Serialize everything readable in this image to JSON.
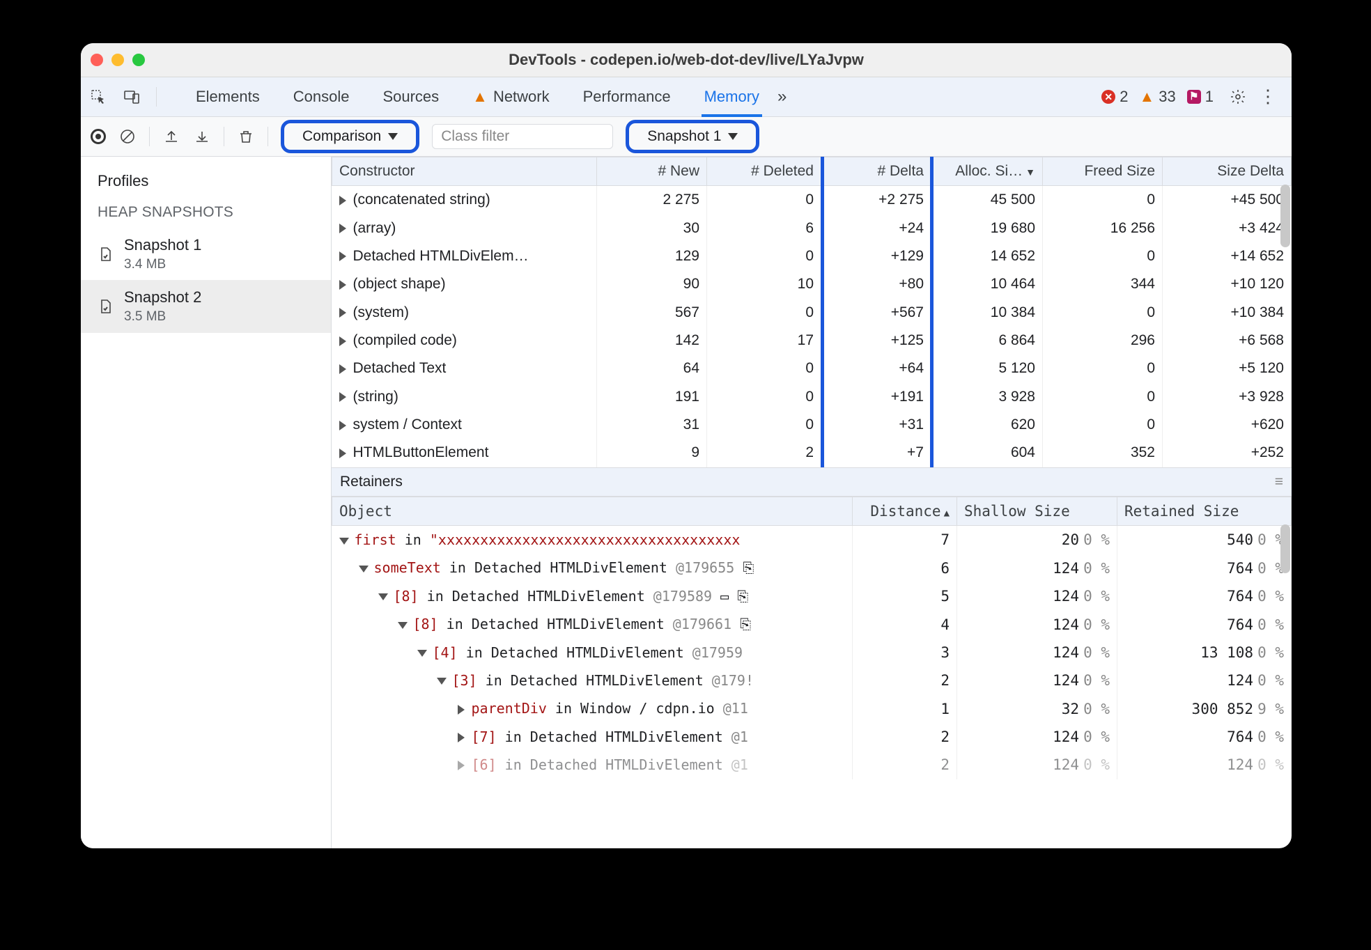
{
  "window": {
    "title": "DevTools - codepen.io/web-dot-dev/live/LYaJvpw"
  },
  "tabs": {
    "items": [
      "Elements",
      "Console",
      "Sources",
      "Network",
      "Performance",
      "Memory"
    ],
    "active": "Memory",
    "more": "»",
    "network_warn": true
  },
  "status": {
    "errors": 2,
    "warnings": 33,
    "issues": 1
  },
  "toolbar": {
    "view_label": "Comparison",
    "filter_placeholder": "Class filter",
    "baseline_label": "Snapshot 1"
  },
  "sidebar": {
    "title": "Profiles",
    "section": "HEAP SNAPSHOTS",
    "snapshots": [
      {
        "name": "Snapshot 1",
        "size": "3.4 MB"
      },
      {
        "name": "Snapshot 2",
        "size": "3.5 MB"
      }
    ],
    "selected": 1
  },
  "columns": {
    "constructor": "Constructor",
    "new": "# New",
    "deleted": "# Deleted",
    "delta": "# Delta",
    "alloc": "Alloc. Si…",
    "freed": "Freed Size",
    "size_delta": "Size Delta"
  },
  "rows": [
    {
      "c": "(concatenated string)",
      "new": "2 275",
      "del": "0",
      "delta": "+2 275",
      "alloc": "45 500",
      "freed": "0",
      "sd": "+45 500"
    },
    {
      "c": "(array)",
      "new": "30",
      "del": "6",
      "delta": "+24",
      "alloc": "19 680",
      "freed": "16 256",
      "sd": "+3 424"
    },
    {
      "c": "Detached HTMLDivElem…",
      "new": "129",
      "del": "0",
      "delta": "+129",
      "alloc": "14 652",
      "freed": "0",
      "sd": "+14 652"
    },
    {
      "c": "(object shape)",
      "new": "90",
      "del": "10",
      "delta": "+80",
      "alloc": "10 464",
      "freed": "344",
      "sd": "+10 120"
    },
    {
      "c": "(system)",
      "new": "567",
      "del": "0",
      "delta": "+567",
      "alloc": "10 384",
      "freed": "0",
      "sd": "+10 384"
    },
    {
      "c": "(compiled code)",
      "new": "142",
      "del": "17",
      "delta": "+125",
      "alloc": "6 864",
      "freed": "296",
      "sd": "+6 568"
    },
    {
      "c": "Detached Text",
      "new": "64",
      "del": "0",
      "delta": "+64",
      "alloc": "5 120",
      "freed": "0",
      "sd": "+5 120"
    },
    {
      "c": "(string)",
      "new": "191",
      "del": "0",
      "delta": "+191",
      "alloc": "3 928",
      "freed": "0",
      "sd": "+3 928"
    },
    {
      "c": "system / Context",
      "new": "31",
      "del": "0",
      "delta": "+31",
      "alloc": "620",
      "freed": "0",
      "sd": "+620"
    },
    {
      "c": "HTMLButtonElement",
      "new": "9",
      "del": "2",
      "delta": "+7",
      "alloc": "604",
      "freed": "352",
      "sd": "+252"
    }
  ],
  "retainers": {
    "title": "Retainers",
    "columns": {
      "object": "Object",
      "distance": "Distance",
      "shallow": "Shallow Size",
      "retained": "Retained Size"
    },
    "rows": [
      {
        "indent": 0,
        "open": true,
        "html": "<span class='k'>first</span> in <span class='s'>\"xxxxxxxxxxxxxxxxxxxxxxxxxxxxxxxxxxxx</span>",
        "dist": "7",
        "sh": "20",
        "shp": "0 %",
        "re": "540",
        "rep": "0 %"
      },
      {
        "indent": 1,
        "open": true,
        "html": "<span class='k'>someText</span> in Detached HTMLDivElement <span class='g'>@179655</span> ⎘",
        "dist": "6",
        "sh": "124",
        "shp": "0 %",
        "re": "764",
        "rep": "0 %"
      },
      {
        "indent": 2,
        "open": true,
        "html": "<span class='k'>[8]</span> in Detached HTMLDivElement <span class='g'>@179589</span> ▭ ⎘",
        "dist": "5",
        "sh": "124",
        "shp": "0 %",
        "re": "764",
        "rep": "0 %"
      },
      {
        "indent": 3,
        "open": true,
        "html": "<span class='k'>[8]</span> in Detached HTMLDivElement <span class='g'>@179661</span> ⎘",
        "dist": "4",
        "sh": "124",
        "shp": "0 %",
        "re": "764",
        "rep": "0 %"
      },
      {
        "indent": 4,
        "open": true,
        "html": "<span class='k'>[4]</span> in Detached HTMLDivElement <span class='g'>@17959</span>",
        "dist": "3",
        "sh": "124",
        "shp": "0 %",
        "re": "13 108",
        "rep": "0 %"
      },
      {
        "indent": 5,
        "open": true,
        "html": "<span class='k'>[3]</span> in Detached HTMLDivElement <span class='g'>@179!</span>",
        "dist": "2",
        "sh": "124",
        "shp": "0 %",
        "re": "124",
        "rep": "0 %"
      },
      {
        "indent": 6,
        "open": false,
        "html": "<span class='k'>parentDiv</span> in Window / cdpn.io <span class='g'>@11</span>",
        "dist": "1",
        "sh": "32",
        "shp": "0 %",
        "re": "300 852",
        "rep": "9 %"
      },
      {
        "indent": 6,
        "open": false,
        "html": "<span class='k'>[7]</span> in Detached HTMLDivElement <span class='g'>@1</span>",
        "dist": "2",
        "sh": "124",
        "shp": "0 %",
        "re": "764",
        "rep": "0 %"
      },
      {
        "indent": 6,
        "open": false,
        "cut": true,
        "html": "<span class='k'>[6]</span> in Detached HTMLDivElement <span class='g'>@1</span>",
        "dist": "2",
        "sh": "124",
        "shp": "0 %",
        "re": "124",
        "rep": "0 %"
      }
    ]
  }
}
